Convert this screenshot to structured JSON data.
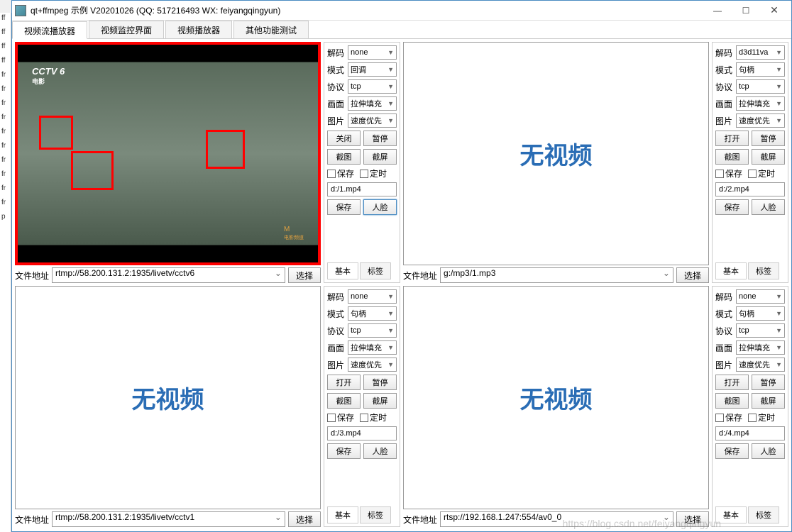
{
  "window": {
    "title": "qt+ffmpeg 示例 V20201026 (QQ: 517216493 WX: feiyangqingyun)"
  },
  "tabs": [
    "视频流播放器",
    "视频监控界面",
    "视频播放器",
    "其他功能测试"
  ],
  "labels": {
    "file_addr": "文件地址",
    "select": "选择",
    "decode": "解码",
    "mode": "模式",
    "protocol": "协议",
    "picture": "画面",
    "image": "图片",
    "close": "关闭",
    "open": "打开",
    "pause": "暂停",
    "capimg": "截图",
    "capscr": "截屏",
    "save": "保存",
    "timer": "定时",
    "savebtn": "保存",
    "face": "人脸",
    "basic": "基本",
    "tag": "标签",
    "novideo": "无视频"
  },
  "panels": [
    {
      "playing": true,
      "addr": "rtmp://58.200.131.2:1935/livetv/cctv6",
      "decode": "none",
      "mode": "回调",
      "protocol": "tcp",
      "picture": "拉伸填充",
      "image": "速度优先",
      "file": "d:/1.mp4",
      "btn1": "关闭"
    },
    {
      "playing": false,
      "addr": "g:/mp3/1.mp3",
      "decode": "d3d11va",
      "mode": "句柄",
      "protocol": "tcp",
      "picture": "拉伸填充",
      "image": "速度优先",
      "file": "d:/2.mp4",
      "btn1": "打开"
    },
    {
      "playing": false,
      "addr": "rtmp://58.200.131.2:1935/livetv/cctv1",
      "decode": "none",
      "mode": "句柄",
      "protocol": "tcp",
      "picture": "拉伸填充",
      "image": "速度优先",
      "file": "d:/3.mp4",
      "btn1": "打开"
    },
    {
      "playing": false,
      "addr": "rtsp://192.168.1.247:554/av0_0",
      "decode": "none",
      "mode": "句柄",
      "protocol": "tcp",
      "picture": "拉伸填充",
      "image": "速度优先",
      "file": "d:/4.mp4",
      "btn1": "打开"
    }
  ],
  "watermark": "https://blog.csdn.net/feiyangqingyun",
  "leftstrip": [
    "ff",
    "ff",
    "ff",
    "ff",
    "fr",
    "fr",
    "fr",
    "fr",
    "fr",
    "fr",
    "fr",
    "fr",
    "fr",
    "fr",
    "p"
  ]
}
